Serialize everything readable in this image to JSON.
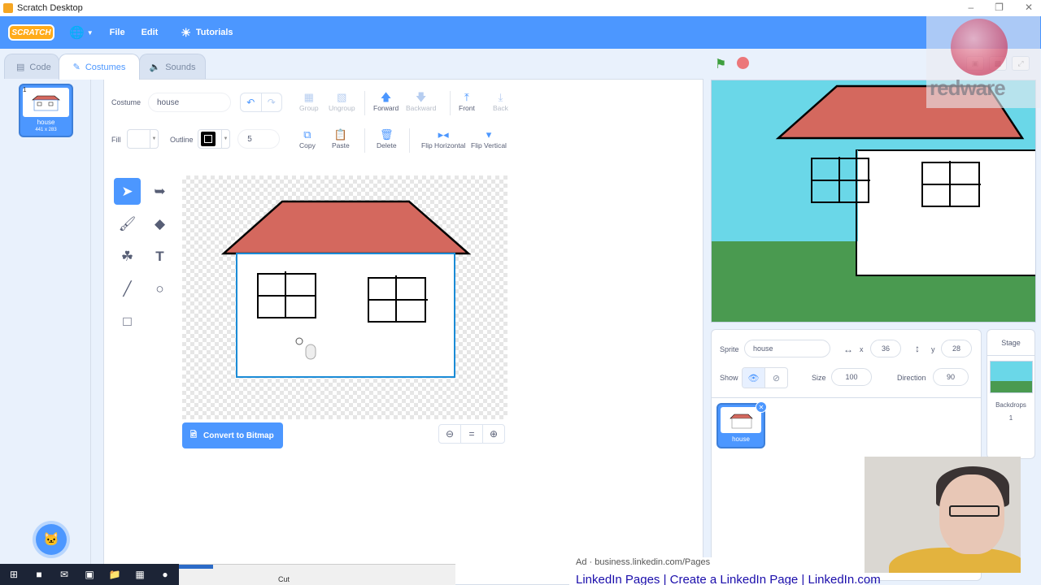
{
  "window": {
    "title": "Scratch Desktop"
  },
  "menu": {
    "logo": "SCRATCH",
    "file": "File",
    "edit": "Edit",
    "tutorials": "Tutorials"
  },
  "tabs": [
    {
      "label": "Code"
    },
    {
      "label": "Costumes"
    },
    {
      "label": "Sounds"
    }
  ],
  "costume_list": {
    "items": [
      {
        "number": "1",
        "name": "house",
        "size": "441 x 283"
      }
    ]
  },
  "paint": {
    "costume_label": "Costume",
    "costume_name": "house",
    "fill_label": "Fill",
    "outline_label": "Outline",
    "outline_width": "5",
    "buttons": {
      "group": "Group",
      "ungroup": "Ungroup",
      "forward": "Forward",
      "backward": "Backward",
      "front": "Front",
      "back": "Back",
      "copy": "Copy",
      "paste": "Paste",
      "delete": "Delete",
      "flip_horizontal": "Flip Horizontal",
      "flip_vertical": "Flip Vertical"
    },
    "convert_button": "Convert to Bitmap",
    "zoom_reset": "="
  },
  "sprite_info": {
    "sprite_label": "Sprite",
    "sprite_name": "house",
    "x_label": "x",
    "x": "36",
    "y_label": "y",
    "y": "28",
    "show_label": "Show",
    "size_label": "Size",
    "size": "100",
    "direction_label": "Direction",
    "direction": "90"
  },
  "sprites": [
    {
      "name": "house"
    }
  ],
  "stage_panel": {
    "title": "Stage",
    "backdrops_label": "Backdrops",
    "backdrops_count": "1"
  },
  "watermark": {
    "text": "redware"
  },
  "overlay": {
    "ad_top": "Ad · business.linkedin.com/Pages",
    "ad_link": "LinkedIn Pages | Create a LinkedIn Page | LinkedIn.com",
    "explorer_cut": "Cut"
  },
  "colors": {
    "scratch_blue": "#4c97ff",
    "roof": "#d4685e",
    "sky": "#6ad7e8",
    "grass": "#4a9a50"
  },
  "icons": {
    "globe": "globe-icon",
    "tutorials": "lightbulb-icon",
    "green_flag": "green-flag-icon",
    "stop": "stop-icon"
  }
}
